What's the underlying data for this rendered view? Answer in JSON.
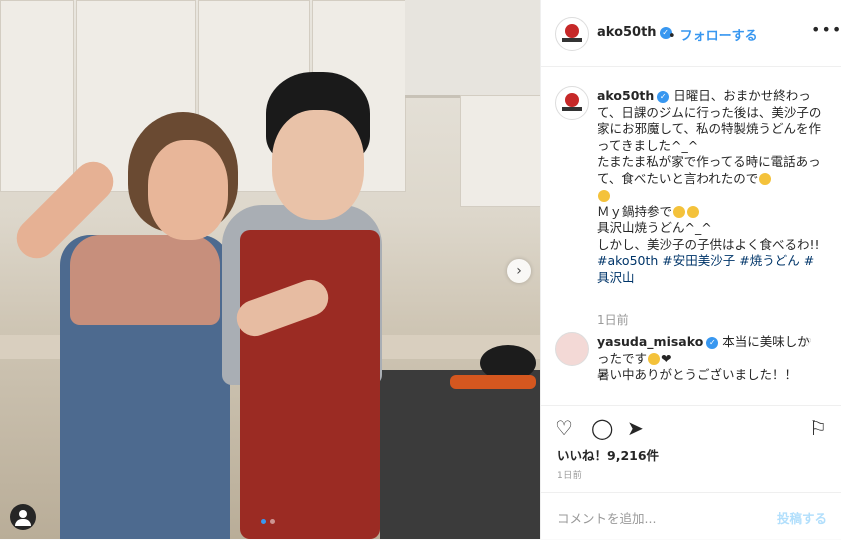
{
  "header": {
    "username": "ako50th",
    "separator": "•",
    "follow_label": "フォローする",
    "more_label": "•••"
  },
  "caption": {
    "username": "ako50th",
    "lines": [
      "日曜日、おまかせ終わって、日課のジムに行った後は、美沙子の家にお邪魔して、私の特製焼うどんを作ってきました^_^",
      "たまたま私が家で作ってる時に電話あって、食べたいと言われたので",
      "Ｍｙ鍋持参で",
      "具沢山焼うどん^_^",
      "しかし、美沙子の子供はよく食べるわ!!"
    ],
    "tags": [
      "#ako50th",
      "#安田美沙子",
      "#焼うどん",
      "#具沢山"
    ],
    "time_ago": "1日前"
  },
  "comment": {
    "username": "yasuda_misako",
    "text_line1": "本当に美味しかったです",
    "text_line2": "暑い中ありがとうございました！！"
  },
  "actions": {
    "like_icon": "heart-icon",
    "comment_icon": "comment-icon",
    "share_icon": "share-icon",
    "save_icon": "bookmark-icon"
  },
  "likes": "いいね！9,216件",
  "date": "1日前",
  "add_comment": {
    "placeholder": "コメントを追加...",
    "post_label": "投稿する"
  },
  "colors": {
    "link": "#3897f0",
    "hashtag": "#003569",
    "muted": "#999999"
  }
}
